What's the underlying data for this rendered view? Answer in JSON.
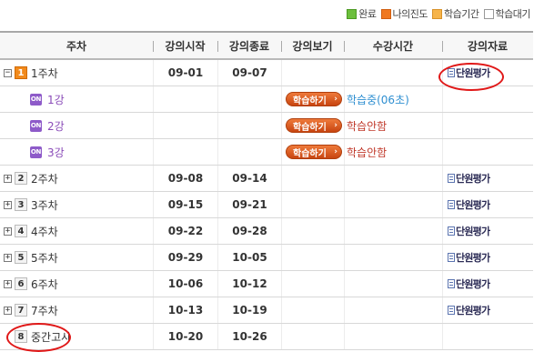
{
  "legend": [
    {
      "label": "완료",
      "color": "#6cbf3c",
      "border": "#4b9a22"
    },
    {
      "label": "나의진도",
      "color": "#f07820",
      "border": "#d05e10"
    },
    {
      "label": "학습기간",
      "color": "#f6b44a",
      "border": "#d8922a"
    },
    {
      "label": "학습대기",
      "color": "#ffffff",
      "border": "#999999"
    }
  ],
  "columns": [
    "주차",
    "강의시작",
    "강의종료",
    "강의보기",
    "수강시간",
    "강의자료"
  ],
  "weeks": [
    {
      "num": "1",
      "label": "1주차",
      "start": "09-01",
      "end": "09-07",
      "toggle": "−",
      "resource": "단원평가",
      "active": true
    },
    {
      "num": "2",
      "label": "2주차",
      "start": "09-08",
      "end": "09-14",
      "toggle": "+",
      "resource": "단원평가"
    },
    {
      "num": "3",
      "label": "3주차",
      "start": "09-15",
      "end": "09-21",
      "toggle": "+",
      "resource": "단원평가"
    },
    {
      "num": "4",
      "label": "4주차",
      "start": "09-22",
      "end": "09-28",
      "toggle": "+",
      "resource": "단원평가"
    },
    {
      "num": "5",
      "label": "5주차",
      "start": "09-29",
      "end": "10-05",
      "toggle": "+",
      "resource": "단원평가"
    },
    {
      "num": "6",
      "label": "6주차",
      "start": "10-06",
      "end": "10-12",
      "toggle": "+",
      "resource": "단원평가"
    },
    {
      "num": "7",
      "label": "7주차",
      "start": "10-13",
      "end": "10-19",
      "toggle": "+",
      "resource": "단원평가"
    },
    {
      "num": "8",
      "label": "중간고사",
      "start": "10-20",
      "end": "10-26",
      "toggle": "",
      "resource": ""
    }
  ],
  "lectures": [
    {
      "badge": "ON",
      "label": "1강",
      "button": "학습하기",
      "status": "학습중(06초)",
      "status_type": "progress"
    },
    {
      "badge": "ON",
      "label": "2강",
      "button": "학습하기",
      "status": "학습안함",
      "status_type": "none"
    },
    {
      "badge": "ON",
      "label": "3강",
      "button": "학습하기",
      "status": "학습안함",
      "status_type": "none"
    }
  ]
}
